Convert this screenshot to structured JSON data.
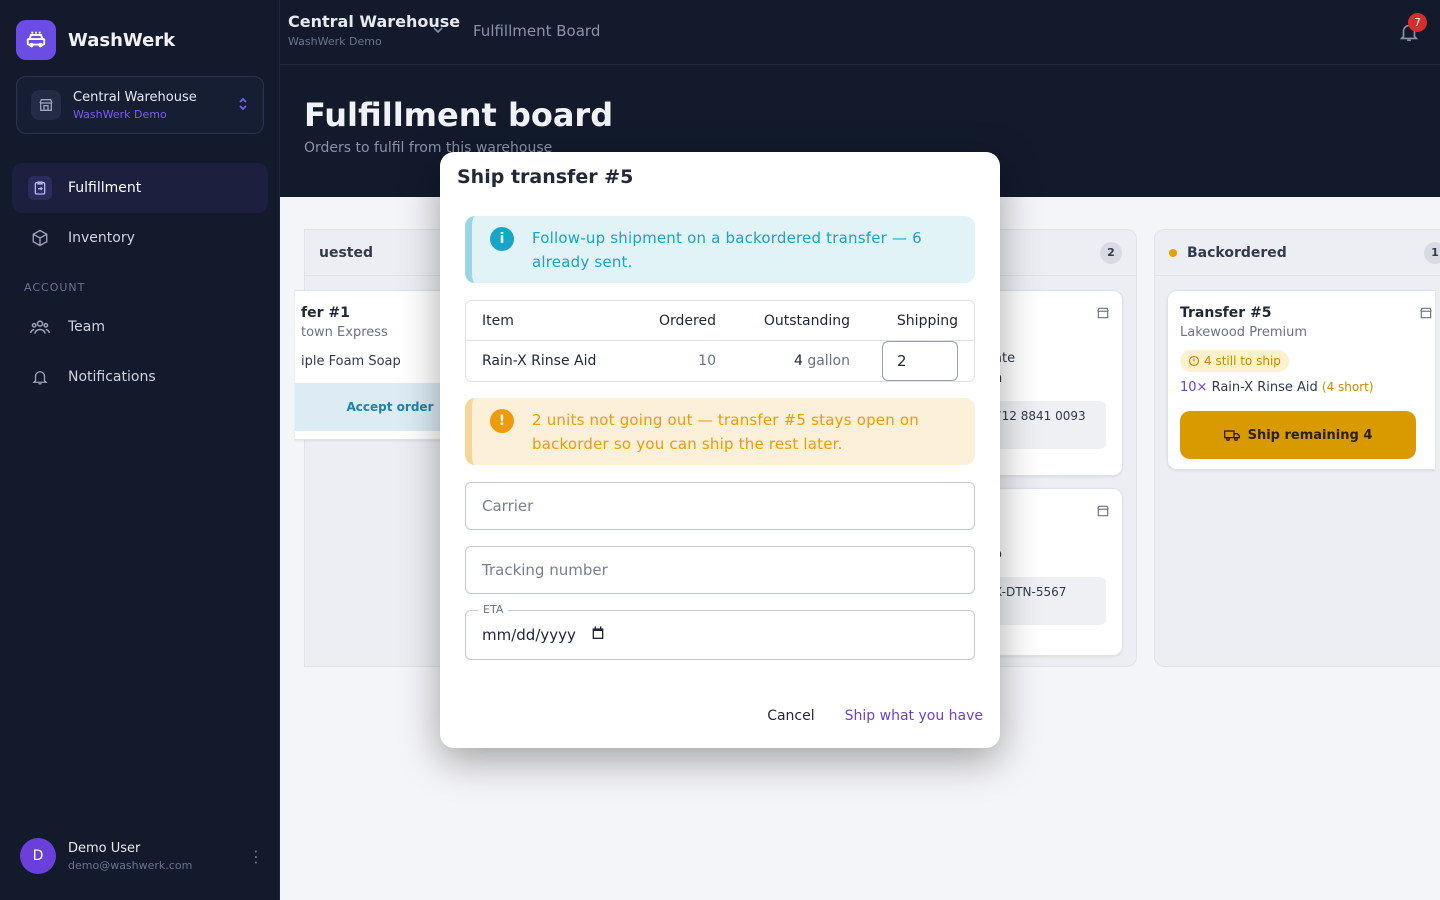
{
  "app": {
    "name": "WashWerk"
  },
  "org": {
    "name": "Central Warehouse",
    "sub": "WashWerk Demo"
  },
  "sidebar": {
    "items": [
      {
        "label": "Fulfillment",
        "icon": "clipboard-icon",
        "active": true
      },
      {
        "label": "Inventory",
        "icon": "box-icon",
        "active": false
      }
    ],
    "section_label": "ACCOUNT",
    "account_items": [
      {
        "label": "Team",
        "icon": "team-icon"
      },
      {
        "label": "Notifications",
        "icon": "bell-icon"
      }
    ]
  },
  "user": {
    "initial": "D",
    "name": "Demo User",
    "email": "demo@washwerk.com"
  },
  "topbar": {
    "warehouse": "Central Warehouse",
    "warehouse_sub": "WashWerk Demo",
    "crumb": "Fulfillment Board",
    "notifications_count": "7"
  },
  "page": {
    "title": "Fulfillment board",
    "subtitle": "Orders to fulfil from this warehouse"
  },
  "board": {
    "col1": {
      "title": "uested",
      "card": {
        "title": "fer #1",
        "sub": "town Express",
        "line": "iple Foam Soap",
        "button": "Accept order"
      }
    },
    "col2": {
      "count": "2",
      "card1": {
        "line1": "ate",
        "line2": "n",
        "box": "712 8841 0093"
      },
      "card2": {
        "line1": "o",
        "box": "X-DTN-5567"
      }
    },
    "col3": {
      "title": "Backordered",
      "count": "1",
      "card": {
        "title": "Transfer #5",
        "sub": "Lakewood Premium",
        "chip": "4 still to ship",
        "qty": "10×",
        "item": "Rain-X Rinse Aid",
        "short": "(4 short)",
        "button": "Ship remaining 4"
      }
    }
  },
  "modal": {
    "title": "Ship transfer #5",
    "info": "Follow-up shipment on a backordered transfer — 6 already sent.",
    "table": {
      "headers": {
        "item": "Item",
        "ordered": "Ordered",
        "outstanding": "Outstanding",
        "shipping": "Shipping"
      },
      "row": {
        "item": "Rain-X Rinse Aid",
        "ordered": "10",
        "outstanding": "4",
        "unit": "gallon",
        "shipping": "2"
      }
    },
    "warning": "2 units not going out — transfer #5 stays open on backorder so you can ship the rest later.",
    "carrier_placeholder": "Carrier",
    "tracking_placeholder": "Tracking number",
    "eta_label": "ETA",
    "eta_value": "mm/dd/yyyy",
    "cancel_label": "Cancel",
    "submit_label": "Ship what you have"
  },
  "colors": {
    "accent": "#6b3fd9",
    "warning": "#ef9a0a",
    "info": "#17a5c8",
    "sidebar_bg": "#131a2c"
  }
}
